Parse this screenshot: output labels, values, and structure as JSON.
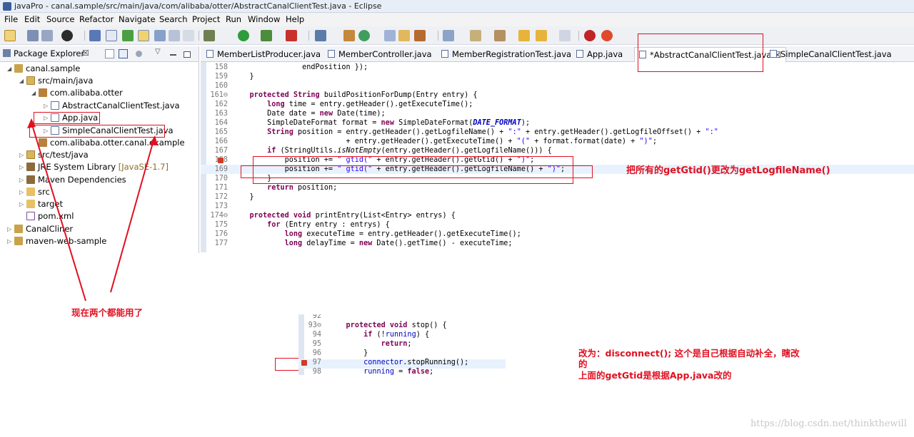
{
  "window": {
    "title": "javaPro - canal.sample/src/main/java/com/alibaba/otter/AbstractCanalClientTest.java - Eclipse"
  },
  "menu": [
    "File",
    "Edit",
    "Source",
    "Refactor",
    "Navigate",
    "Search",
    "Project",
    "Run",
    "Window",
    "Help"
  ],
  "package_explorer": {
    "tab_label": "Package Explorer",
    "close_glyph": "☒",
    "tree": [
      {
        "label": "canal.sample",
        "icon": "project-icon"
      },
      {
        "label": "src/main/java",
        "icon": "source-folder-icon"
      },
      {
        "label": "com.alibaba.otter",
        "icon": "package-icon"
      },
      {
        "label": "AbstractCanalClientTest.java",
        "icon": "java-file-icon"
      },
      {
        "label": "App.java",
        "icon": "java-file-icon"
      },
      {
        "label": "SimpleCanalClientTest.java",
        "icon": "java-file-icon"
      },
      {
        "label": "com.alibaba.otter.canal.example",
        "icon": "package-icon"
      },
      {
        "label": "src/test/java",
        "icon": "source-folder-icon"
      },
      {
        "label": "JRE System Library",
        "suffix": "[JavaSE-1.7]",
        "icon": "library-icon"
      },
      {
        "label": "Maven Dependencies",
        "icon": "library-icon"
      },
      {
        "label": "src",
        "icon": "folder-icon"
      },
      {
        "label": "target",
        "icon": "folder-icon"
      },
      {
        "label": "pom.xml",
        "icon": "xml-file-icon"
      },
      {
        "label": "CanalCliner",
        "icon": "project-icon"
      },
      {
        "label": "maven-web-sample",
        "icon": "project-icon"
      }
    ]
  },
  "editor_tabs": [
    {
      "label": "MemberListProducer.java"
    },
    {
      "label": "MemberController.java"
    },
    {
      "label": "MemberRegistrationTest.java"
    },
    {
      "label": "App.java"
    },
    {
      "label": "*AbstractCanalClientTest.java",
      "close": "☒"
    },
    {
      "label": "SimpleCanalClientTest.java"
    }
  ],
  "code": {
    "lines": [
      {
        "n": "158",
        "text": "                endPosition });"
      },
      {
        "n": "159",
        "text": "    }"
      },
      {
        "n": "160",
        "text": ""
      },
      {
        "n": "161⊖",
        "text": "    protected String buildPositionForDump(Entry entry) {"
      },
      {
        "n": "162",
        "text": "        long time = entry.getHeader().getExecuteTime();"
      },
      {
        "n": "163",
        "text": "        Date date = new Date(time);"
      },
      {
        "n": "164",
        "text": "        SimpleDateFormat format = new SimpleDateFormat(DATE_FORMAT);"
      },
      {
        "n": "165",
        "text": "        String position = entry.getHeader().getLogfileName() + \":\" + entry.getHeader().getLogfileOffset() + \":\""
      },
      {
        "n": "166",
        "text": "                          + entry.getHeader().getExecuteTime() + \"(\" + format.format(date) + \")\";"
      },
      {
        "n": "167",
        "text": "        if (StringUtils.isNotEmpty(entry.getHeader().getLogfileName())) {"
      },
      {
        "n": "168",
        "text": "            position += \" gtid(\" + entry.getHeader().getGtid() + \")\";"
      },
      {
        "n": "169",
        "text": "            position += \" gtid(\" + entry.getHeader().getLogfileName() + \")\";"
      },
      {
        "n": "170",
        "text": "        }"
      },
      {
        "n": "171",
        "text": "        return position;"
      },
      {
        "n": "172",
        "text": "    }"
      },
      {
        "n": "173",
        "text": ""
      },
      {
        "n": "174⊖",
        "text": "    protected void printEntry(List<Entry> entrys) {"
      },
      {
        "n": "175",
        "text": "        for (Entry entry : entrys) {"
      },
      {
        "n": "176",
        "text": "            long executeTime = entry.getHeader().getExecuteTime();"
      },
      {
        "n": "177",
        "text": "            long delayTime = new Date().getTime() - executeTime;"
      }
    ]
  },
  "snippet": {
    "lines": [
      {
        "n": "92",
        "text": ""
      },
      {
        "n": "93⊖",
        "text": "    protected void stop() {"
      },
      {
        "n": "94",
        "text": "        if (!running) {"
      },
      {
        "n": "95",
        "text": "            return;"
      },
      {
        "n": "96",
        "text": "        }"
      },
      {
        "n": "97",
        "text": "        connector.stopRunning();"
      },
      {
        "n": "98",
        "text": "        running = false;"
      }
    ]
  },
  "annotations": {
    "replace_note": "把所有的getGtid()更改为getLogfileName()",
    "both_work": "现在两个都能用了",
    "disconnect_note_1": "改为：disconnect(); 这个是自己根据自动补全，瞎改",
    "disconnect_note_2": "的",
    "disconnect_note_3": "上面的getGtid是根据App.java改的"
  },
  "watermark": "https://blog.csdn.net/thinkthewill",
  "colors": {
    "annotation": "#e01020",
    "keyword": "#7f0055",
    "string": "#2a00ff"
  }
}
